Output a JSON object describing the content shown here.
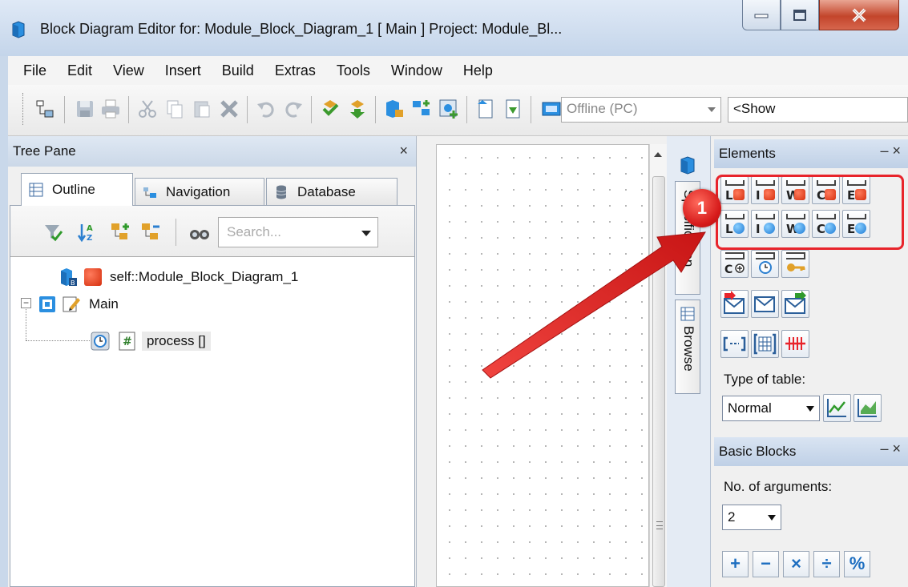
{
  "window": {
    "title": "Block Diagram Editor for: Module_Block_Diagram_1 [ Main ] Project: Module_Bl...",
    "controls": [
      "minimize",
      "maximize",
      "close"
    ]
  },
  "menu": {
    "items": [
      "File",
      "Edit",
      "View",
      "Insert",
      "Build",
      "Extras",
      "Tools",
      "Window",
      "Help"
    ]
  },
  "toolbar": {
    "mode_value": "Offline (PC)",
    "filter_value": "<Show"
  },
  "tree_pane": {
    "title": "Tree Pane",
    "close_label": "×",
    "tabs": [
      {
        "label": "Outline"
      },
      {
        "label": "Navigation"
      },
      {
        "label": "Database"
      }
    ],
    "search_placeholder": "Search...",
    "tree": [
      {
        "label": "self::Module_Block_Diagram_1"
      },
      {
        "label": "Main",
        "expander": "−"
      },
      {
        "label": "process []"
      }
    ]
  },
  "side_tabs": [
    {
      "label": "Specification"
    },
    {
      "label": "Browse"
    }
  ],
  "elements_pane": {
    "title": "Elements",
    "header_controls": "– ×",
    "row1_letters": [
      "L",
      "I",
      "W",
      "C",
      "E"
    ],
    "row2_letters": [
      "L",
      "I",
      "W",
      "C",
      "E"
    ],
    "type_of_table_label": "Type of table:",
    "type_of_table_value": "Normal"
  },
  "basic_blocks_pane": {
    "title": "Basic Blocks",
    "header_controls": "– ×",
    "args_label": "No. of arguments:",
    "args_value": "2",
    "operators": [
      "+",
      "−",
      "×",
      "÷",
      "%"
    ]
  },
  "annotation": {
    "step_number": "1"
  },
  "colors": {
    "annotation_red": "#e8242b",
    "titlebar": "#c4d5ea",
    "close_button": "#c3452b"
  }
}
